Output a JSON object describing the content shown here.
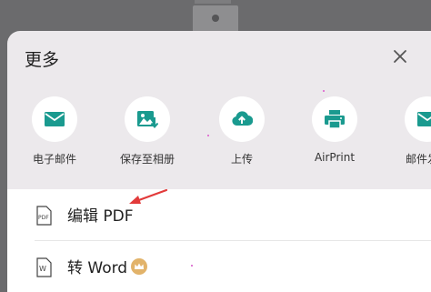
{
  "sheet": {
    "title": "更多"
  },
  "share_items": [
    {
      "label": "电子邮件",
      "icon": "mail-icon"
    },
    {
      "label": "保存至相册",
      "icon": "save-photo-icon"
    },
    {
      "label": "上传",
      "icon": "cloud-upload-icon"
    },
    {
      "label": "AirPrint",
      "icon": "printer-icon"
    },
    {
      "label": "邮件发送",
      "icon": "mail-send-icon"
    }
  ],
  "actions": [
    {
      "label": "编辑 PDF",
      "icon": "pdf-icon"
    },
    {
      "label": "转 Word",
      "icon": "word-icon",
      "badge_icon": "crown-icon"
    }
  ],
  "colors": {
    "icon_teal": "#1a9a8f",
    "annotation_red": "#e23a3a"
  }
}
